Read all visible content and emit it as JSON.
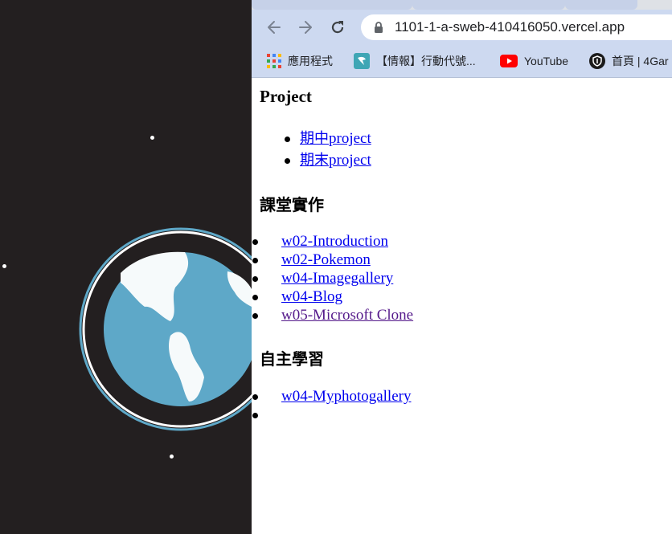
{
  "browser": {
    "url": "1101-1-a-sweb-410416050.vercel.app",
    "bookmarks": [
      {
        "label": "應用程式",
        "icon": "apps-grid-icon"
      },
      {
        "label": "【情報】行動代號...",
        "icon": "bahamut-icon"
      },
      {
        "label": "YouTube",
        "icon": "youtube-icon"
      },
      {
        "label": "首頁 | 4Gar",
        "icon": "shield-icon"
      }
    ]
  },
  "page": {
    "project_heading": "Project",
    "project_links": [
      {
        "zh": "期中",
        "en": "project"
      },
      {
        "zh": "期末",
        "en": "project"
      }
    ],
    "class_heading": "課堂實作",
    "class_links": [
      "w02-Introduction",
      "w02-Pokemon",
      "w04-Imagegallery",
      "w04-Blog",
      "w05-Microsoft Clone"
    ],
    "self_heading": "自主學習",
    "self_links": [
      "w04-Myphotogallery",
      ""
    ]
  },
  "colors": {
    "desktop": "#231f20",
    "globe": "#5ea8c8",
    "toolbar": "#cdd9f0",
    "link": "#0000ee",
    "visited": "#551a8b"
  }
}
